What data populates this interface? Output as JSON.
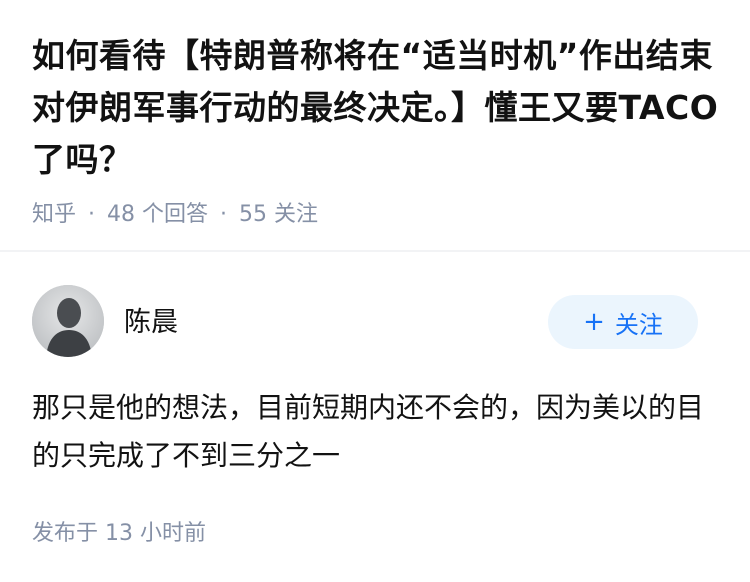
{
  "question": {
    "title": "如何看待【特朗普称将在“适当时机”作出结束对伊朗军事行动的最终决定。】懂王又要TACO了吗？",
    "source": "知乎",
    "separator": "·",
    "answers_count": "48 个回答",
    "followers_count": "55 关注"
  },
  "author": {
    "name": "陈晨",
    "avatar_icon": "person-silhouette-icon",
    "follow_plus": "+",
    "follow_label": "关注"
  },
  "answer": {
    "text": "那只是他的想法，目前短期内还不会的，因为美以的目的只完成了不到三分之一",
    "published": "发布于 13 小时前"
  },
  "colors": {
    "accent": "#1772f6",
    "follow_bg": "#ebf5fd",
    "meta": "#8590a6",
    "text": "#121212"
  }
}
